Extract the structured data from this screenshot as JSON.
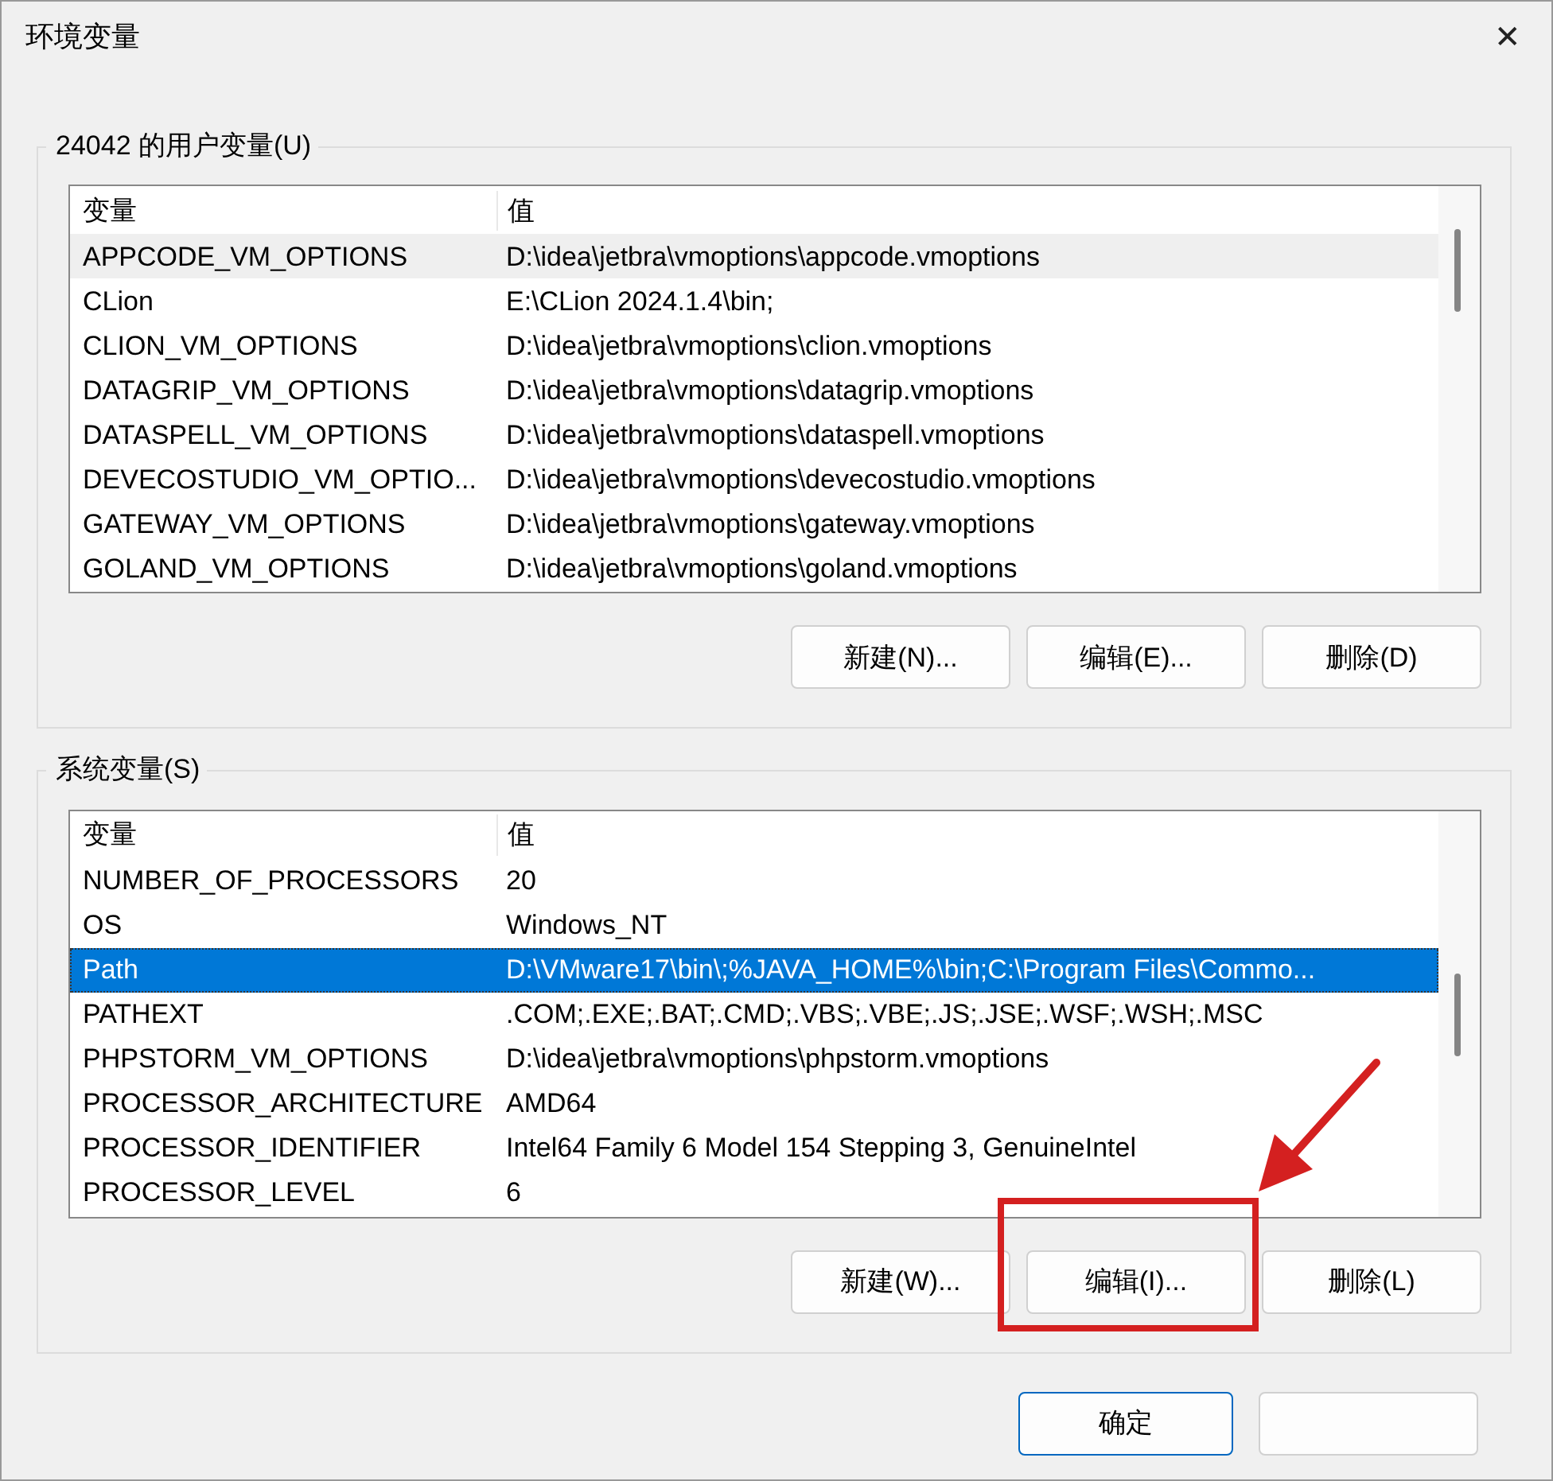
{
  "window": {
    "title": "环境变量",
    "close": "✕"
  },
  "user_variables": {
    "title": "24042 的用户变量(U)",
    "columns": [
      "变量",
      "值"
    ],
    "rows": [
      {
        "name": "APPCODE_VM_OPTIONS",
        "value": "D:\\idea\\jetbra\\vmoptions\\appcode.vmoptions",
        "selected": false,
        "hovered": true
      },
      {
        "name": "CLion",
        "value": "E:\\CLion 2024.1.4\\bin;",
        "selected": false,
        "hovered": false
      },
      {
        "name": "CLION_VM_OPTIONS",
        "value": "D:\\idea\\jetbra\\vmoptions\\clion.vmoptions",
        "selected": false,
        "hovered": false
      },
      {
        "name": "DATAGRIP_VM_OPTIONS",
        "value": "D:\\idea\\jetbra\\vmoptions\\datagrip.vmoptions",
        "selected": false,
        "hovered": false
      },
      {
        "name": "DATASPELL_VM_OPTIONS",
        "value": "D:\\idea\\jetbra\\vmoptions\\dataspell.vmoptions",
        "selected": false,
        "hovered": false
      },
      {
        "name": "DEVECOSTUDIO_VM_OPTIO...",
        "value": "D:\\idea\\jetbra\\vmoptions\\devecostudio.vmoptions",
        "selected": false,
        "hovered": false
      },
      {
        "name": "GATEWAY_VM_OPTIONS",
        "value": "D:\\idea\\jetbra\\vmoptions\\gateway.vmoptions",
        "selected": false,
        "hovered": false
      },
      {
        "name": "GOLAND_VM_OPTIONS",
        "value": "D:\\idea\\jetbra\\vmoptions\\goland.vmoptions",
        "selected": false,
        "hovered": false
      }
    ],
    "buttons": [
      "新建(N)...",
      "编辑(E)...",
      "删除(D)"
    ]
  },
  "system_variables": {
    "title": "系统变量(S)",
    "columns": [
      "变量",
      "值"
    ],
    "rows": [
      {
        "name": "NUMBER_OF_PROCESSORS",
        "value": "20",
        "selected": false,
        "hovered": false
      },
      {
        "name": "OS",
        "value": "Windows_NT",
        "selected": false,
        "hovered": false
      },
      {
        "name": "Path",
        "value": "D:\\VMware17\\bin\\;%JAVA_HOME%\\bin;C:\\Program Files\\Commo...",
        "selected": true,
        "hovered": false
      },
      {
        "name": "PATHEXT",
        "value": ".COM;.EXE;.BAT;.CMD;.VBS;.VBE;.JS;.JSE;.WSF;.WSH;.MSC",
        "selected": false,
        "hovered": false
      },
      {
        "name": "PHPSTORM_VM_OPTIONS",
        "value": "D:\\idea\\jetbra\\vmoptions\\phpstorm.vmoptions",
        "selected": false,
        "hovered": false
      },
      {
        "name": "PROCESSOR_ARCHITECTURE",
        "value": "AMD64",
        "selected": false,
        "hovered": false
      },
      {
        "name": "PROCESSOR_IDENTIFIER",
        "value": "Intel64 Family 6 Model 154 Stepping 3, GenuineIntel",
        "selected": false,
        "hovered": false
      },
      {
        "name": "PROCESSOR_LEVEL",
        "value": "6",
        "selected": false,
        "hovered": false
      }
    ],
    "buttons": [
      "新建(W)...",
      "编辑(I)...",
      "删除(L)"
    ]
  },
  "footer_buttons": [
    {
      "label": "确定",
      "default": true
    },
    {
      "default": false
    }
  ],
  "annotations": [
    {
      "kind": "highlight-box"
    },
    {
      "kind": "arrow"
    }
  ]
}
